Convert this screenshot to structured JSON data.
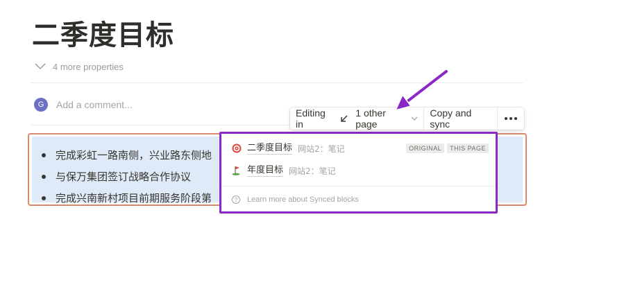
{
  "page": {
    "title": "二季度目标",
    "properties_toggle": "4 more properties"
  },
  "comment": {
    "avatar_initial": "G",
    "placeholder": "Add a comment..."
  },
  "synced_block": {
    "items": [
      "完成彩虹一路南侧，兴业路东侧地",
      "与保万集团签订战略合作协议",
      "完成兴南新村项目前期服务阶段第"
    ]
  },
  "toolbar": {
    "editing_in": "Editing in",
    "other_pages": "1 other page",
    "copy_and_sync": "Copy and sync"
  },
  "dropdown": {
    "pages": [
      {
        "icon": "target-icon",
        "name": "二季度目标",
        "path": "网站2：笔记",
        "badges": [
          "ORIGINAL",
          "THIS PAGE"
        ]
      },
      {
        "icon": "golf-flag-icon",
        "name": "年度目标",
        "path": "网站2：笔记",
        "badges": []
      }
    ],
    "help_text": "Learn more about Synced blocks"
  },
  "colors": {
    "synced_border": "#d98a6c",
    "synced_bg": "#dfeaf8",
    "annotation": "#8b28c8",
    "avatar": "#6b70c4"
  }
}
